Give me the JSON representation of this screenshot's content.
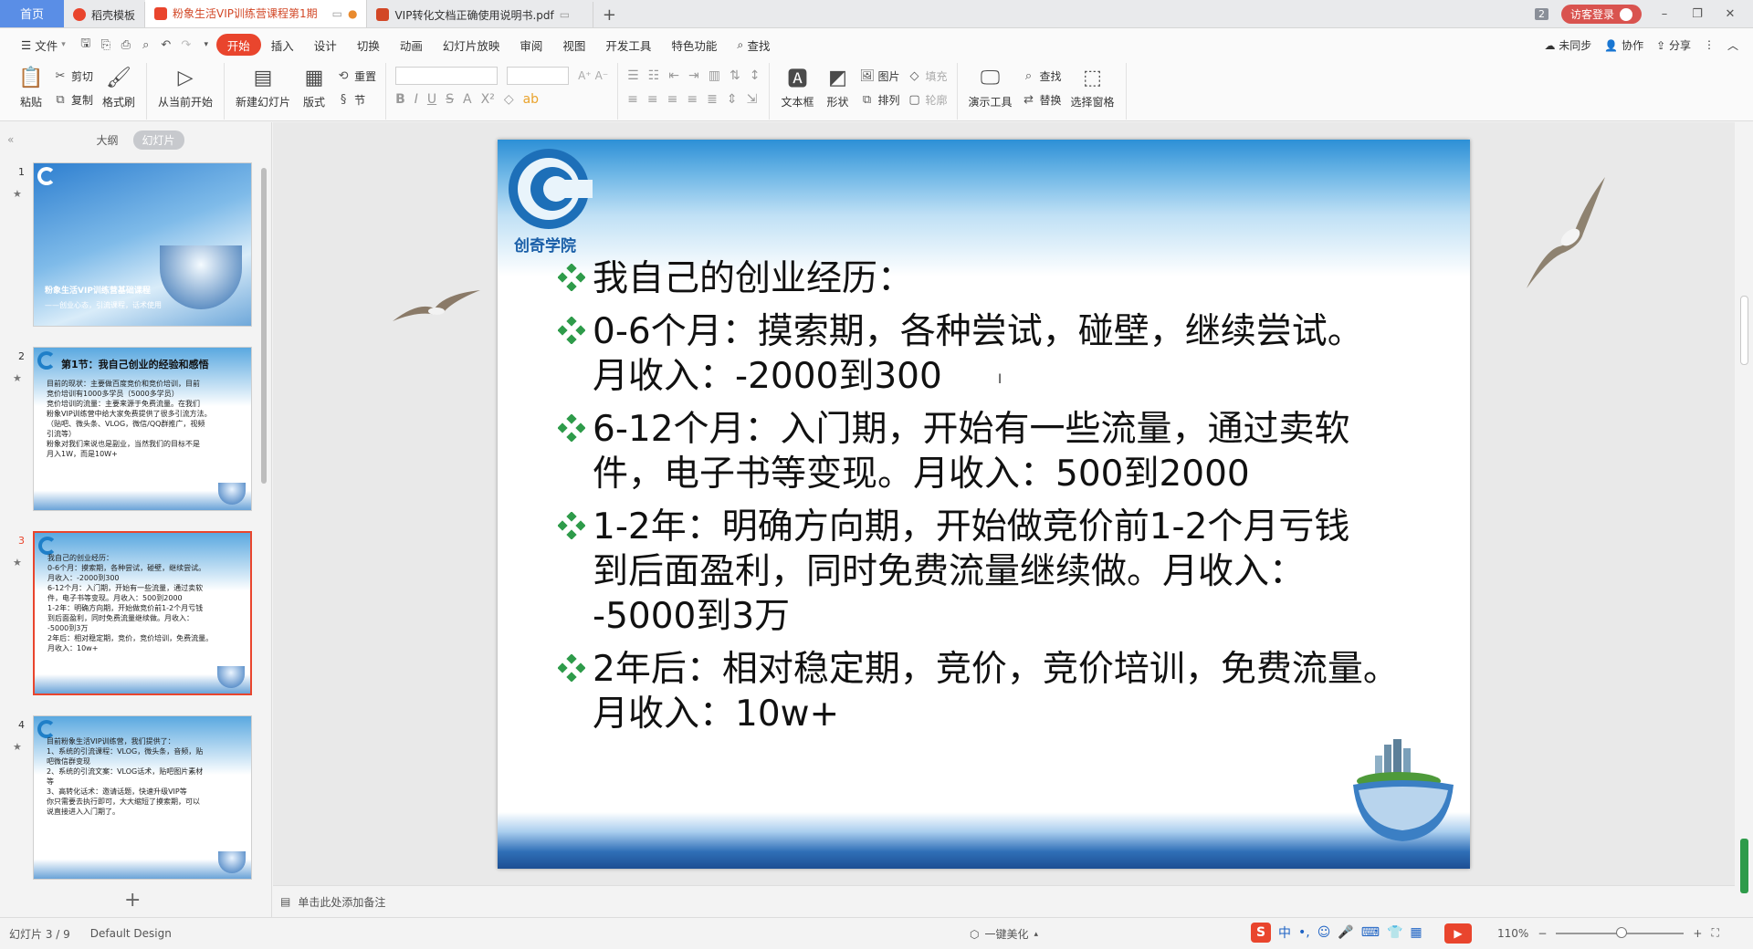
{
  "tabs": {
    "home": "首页",
    "items": [
      {
        "label": "稻壳模板",
        "color": "#e9452d"
      },
      {
        "label": "粉象生活VIP训练营课程第1期",
        "color": "#e9452d",
        "active": true
      },
      {
        "label": "VIP转化文档正确使用说明书.pdf",
        "color": "#d24726"
      }
    ],
    "add": "+",
    "count_badge": "2",
    "visitor_login": "访客登录"
  },
  "menu": {
    "file": "文件",
    "items": [
      "开始",
      "插入",
      "设计",
      "切换",
      "动画",
      "幻灯片放映",
      "审阅",
      "视图",
      "开发工具",
      "特色功能"
    ],
    "search": "查找",
    "right": [
      "未同步",
      "协作",
      "分享"
    ]
  },
  "ribbon": {
    "paste": "粘贴",
    "cut": "剪切",
    "copy": "复制",
    "format_painter": "格式刷",
    "from_current": "从当前开始",
    "new_slide": "新建幻灯片",
    "layout": "版式",
    "reset": "重置",
    "section": "节",
    "textbox": "文本框",
    "shape": "形状",
    "picture": "图片",
    "fill": "填充",
    "arrange": "排列",
    "outline": "轮廓",
    "present_tool": "演示工具",
    "find": "查找",
    "replace": "替换",
    "select_pane": "选择窗格"
  },
  "left_panel": {
    "tab_outline": "大纲",
    "tab_slides": "幻灯片",
    "slides": [
      {
        "num": "1",
        "title": "粉象生活VIP训练营基础课程",
        "subtitle": "——创业心态，引流课程，话术使用"
      },
      {
        "num": "2",
        "title": "第1节：我自己创业的经验和感悟",
        "lines": [
          "目前的现状：主要做百度竞价和竞价培训，目前",
          "竞价培训有1000多学员（5000多学员）",
          "竞价培训的流量：主要来源于免费流量。在我们",
          "粉象VIP训练营中给大家免费提供了很多引流方法。",
          "（贴吧、微头条、VLOG，微信/QQ群推广，视频",
          "引流等）",
          "粉象对我们来说也是副业，当然我们的目标不是",
          "月入1W，而是10W+"
        ]
      },
      {
        "num": "3",
        "lines": [
          "我自己的创业经历：",
          "0-6个月：摸索期，各种尝试，碰壁，继续尝试。",
          "月收入：-2000到300",
          "6-12个月：入门期，开始有一些流量，通过卖软",
          "件，电子书等变现。月收入：500到2000",
          "1-2年：明确方向期，开始做竞价前1-2个月亏钱",
          "到后面盈利，同时免费流量继续做。月收入：",
          "-5000到3万",
          "2年后：相对稳定期，竞价，竞价培训，免费流量。",
          "月收入：10w+"
        ]
      },
      {
        "num": "4",
        "lines": [
          "目前粉象生活VIP训练营，我们提供了：",
          "1、系统的引流课程：VLOG，微头条，音频，贴",
          "吧微信群变现",
          "2、系统的引流文案：VLOG话术，贴吧图片素材",
          "等",
          "3、高转化话术：邀请话题，快速升级VIP等",
          "你只需要去执行即可，大大缩短了摸索期，可以",
          "说直接进入入门期了。"
        ]
      }
    ],
    "add_slide": "+"
  },
  "slide": {
    "logo_text": "创奇学院",
    "bullets": [
      {
        "lines": [
          "我自己的创业经历："
        ]
      },
      {
        "lines": [
          "0-6个月：摸索期，各种尝试，碰壁，继续尝试。",
          "月收入：-2000到300"
        ]
      },
      {
        "lines": [
          "6-12个月：入门期，开始有一些流量，通过卖软",
          "件，电子书等变现。月收入：500到2000"
        ]
      },
      {
        "lines": [
          "1-2年：明确方向期，开始做竞价前1-2个月亏钱",
          "到后面盈利，同时免费流量继续做。月收入：",
          "-5000到3万"
        ]
      },
      {
        "lines": [
          "2年后：相对稳定期，竞价，竞价培训，免费流量。",
          "月收入：10w+"
        ]
      }
    ]
  },
  "notes_placeholder": "单击此处添加备注",
  "status": {
    "slide_counter": "幻灯片 3 / 9",
    "design": "Default Design",
    "beautify": "一键美化",
    "ime_label": "中",
    "zoom": "110%"
  },
  "colors": {
    "accent": "#e9452d",
    "home_tab": "#5a8ee6"
  }
}
